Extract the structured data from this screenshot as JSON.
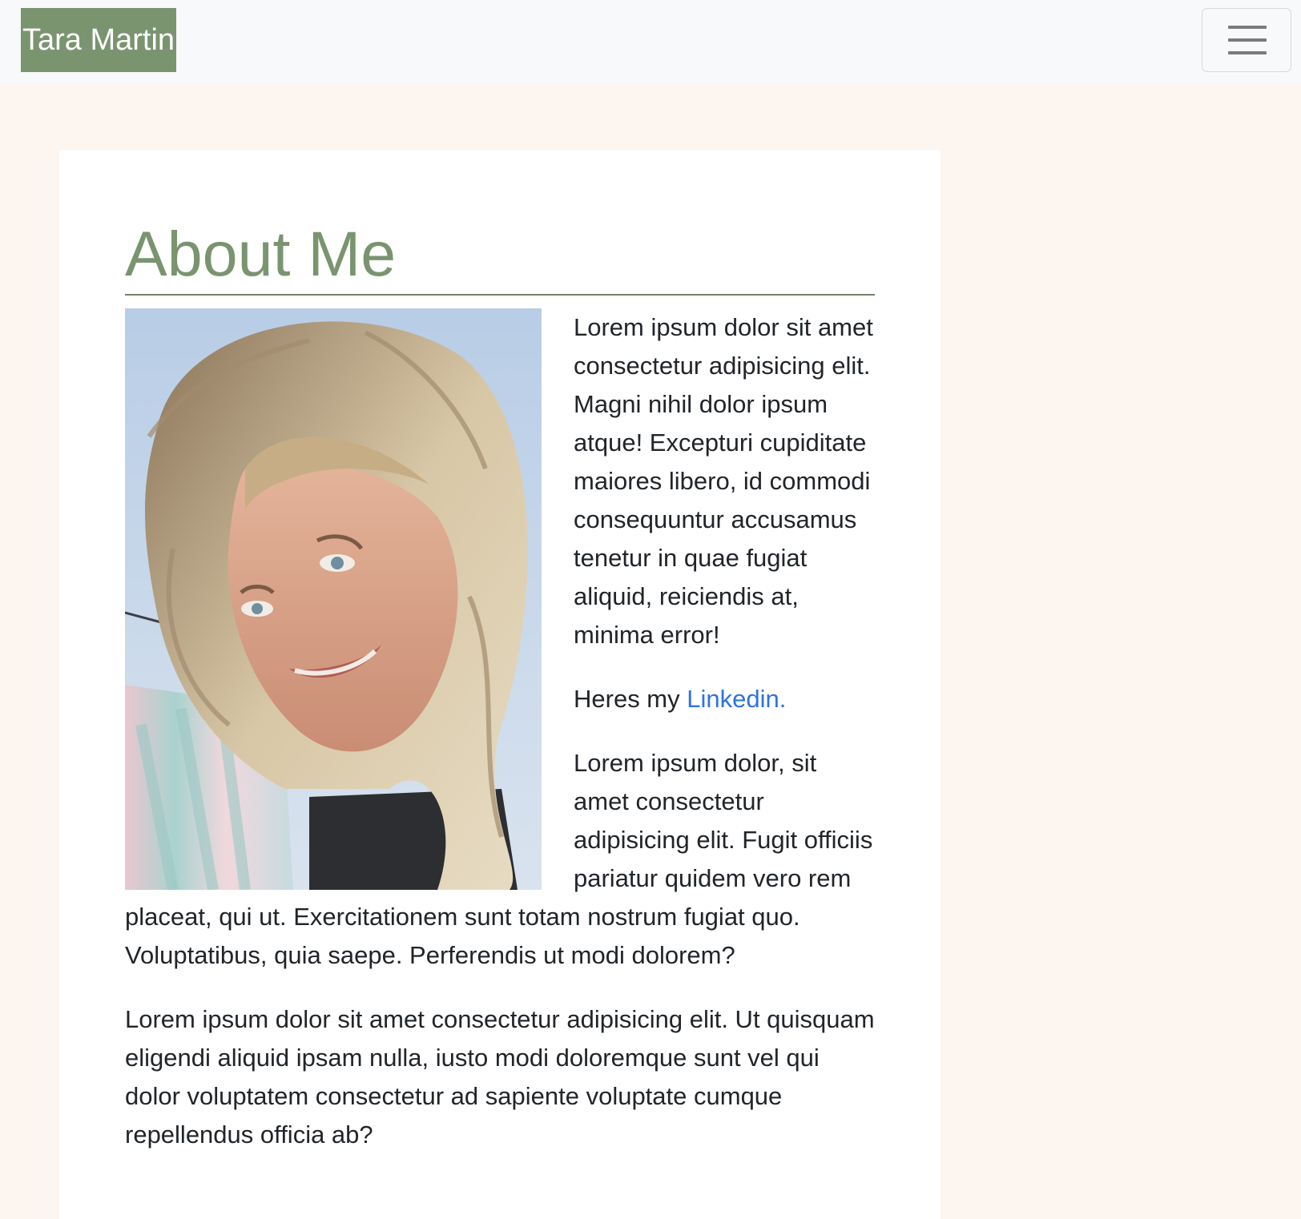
{
  "navbar": {
    "brand": "Tara Martin",
    "toggler_icon": "hamburger-menu-icon"
  },
  "about": {
    "title": "About Me",
    "photo_icon": "profile-photo",
    "paragraph1": "Lorem ipsum dolor sit amet consectetur adipisicing elit. Magni nihil dolor ipsum atque! Excepturi cupiditate maiores libero, id commodi consequuntur accusamus tenetur in quae fugiat aliquid, reiciendis at, minima error!",
    "linkedin_prefix": "Heres my ",
    "linkedin_label": "Linkedin.",
    "paragraph2": "Lorem ipsum dolor, sit amet consectetur adipisicing elit. Fugit officiis pariatur quidem vero rem placeat, qui ut. Exercitationem sunt totam nostrum fugiat quo. Voluptatibus, quia saepe. Perferendis ut modi dolorem?",
    "paragraph3": "Lorem ipsum dolor sit amet consectetur adipisicing elit. Ut quisquam eligendi aliquid ipsam nulla, iusto modi doloremque sunt vel qui dolor voluptatem consectetur ad sapiente voluptate cumque repellendus officia ab?"
  },
  "colors": {
    "page_background": "#fdf5f0",
    "navbar_background": "#f8f9fa",
    "brand_background": "#7a9470",
    "accent": "#7a9470",
    "link": "#2f73e0",
    "text": "#212529"
  }
}
